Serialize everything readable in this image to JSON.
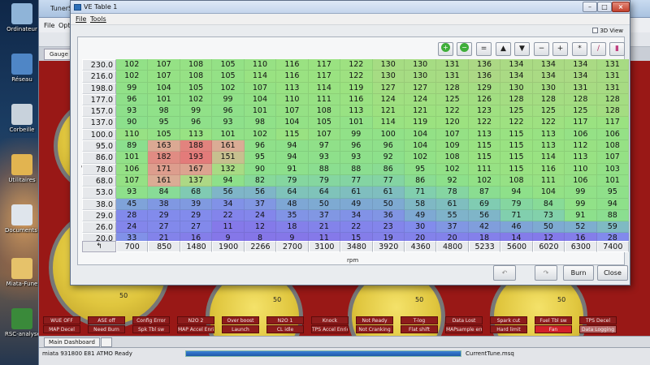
{
  "desktop": {
    "icons": [
      {
        "label": "Ordinateur",
        "color": "#8fb4d8"
      },
      {
        "label": "Réseau",
        "color": "#4f86c6"
      },
      {
        "label": "Corbeille",
        "color": "#c8d2dc"
      },
      {
        "label": "Utilitaires",
        "color": "#e2b450"
      },
      {
        "label": "Documents Raccourci",
        "color": "#dfe5ec"
      },
      {
        "label": "Miata-Fune",
        "color": "#e6c26a"
      },
      {
        "label": "RSC-analyse Raccourci",
        "color": "#3a8a3a"
      }
    ]
  },
  "bg_window": {
    "title": "TunerS",
    "menu": [
      "File",
      "Opti"
    ],
    "tab": "Gauge Cl",
    "gauge_labels": [
      "50",
      "50",
      "50",
      "50"
    ],
    "indicators_row1": [
      "WUE OFF",
      "ASE off",
      "Config Error",
      "N2O 2",
      "Over boost",
      "N2O 1",
      "Knock",
      "Not Ready",
      "T-log",
      "Data Lost",
      "Spark cut",
      "Fuel Tbl sw",
      "TPS Decel"
    ],
    "indicators_row2": [
      "MAP Decel",
      "Need Burn",
      "Spk Tbl sw",
      "MAP Accel Enrich",
      "Launch",
      "CL idle",
      "TPS Accel Enrich",
      "Not Cranking",
      "Flat shift",
      "MAPsample error",
      "Hard limit",
      "Fan",
      "Data Logging"
    ],
    "main_tab": "Main Dashboard",
    "status_left": "miata 931800 E81 ATMO Ready",
    "status_right": "CurrentTune.msq",
    "progress": 1.0
  },
  "dialog": {
    "title": "VE Table 1",
    "menu": [
      "File",
      "Tools"
    ],
    "view3d_label": "3D View",
    "side_axis_label": [
      "f",
      "u",
      "e",
      "l",
      "l",
      "o",
      "a",
      "d",
      "",
      "%"
    ],
    "toolbar": [
      "+",
      "−",
      "=",
      "▲",
      "▼",
      "−",
      "+",
      "*",
      "/",
      "▮"
    ],
    "corner_icon": "↰",
    "x_axis_title": "rpm",
    "burn_label": "Burn",
    "close_label": "Close",
    "y_axis": [
      "230.0",
      "216.0",
      "198.0",
      "177.0",
      "157.0",
      "137.0",
      "100.0",
      "95.0",
      "86.0",
      "78.0",
      "68.0",
      "53.0",
      "38.0",
      "29.0",
      "26.0",
      "20.0"
    ],
    "x_axis": [
      "700",
      "850",
      "1480",
      "1900",
      "2266",
      "2700",
      "3100",
      "3480",
      "3920",
      "4360",
      "4800",
      "5233",
      "5600",
      "6020",
      "6300",
      "7400"
    ],
    "table": [
      [
        102,
        107,
        108,
        105,
        110,
        116,
        117,
        122,
        130,
        130,
        131,
        136,
        134,
        134,
        134,
        131
      ],
      [
        102,
        107,
        108,
        105,
        114,
        116,
        117,
        122,
        130,
        130,
        131,
        136,
        134,
        134,
        134,
        131
      ],
      [
        99,
        104,
        105,
        102,
        107,
        113,
        114,
        119,
        127,
        127,
        128,
        129,
        130,
        130,
        131,
        131
      ],
      [
        96,
        101,
        102,
        99,
        104,
        110,
        111,
        116,
        124,
        124,
        125,
        126,
        128,
        128,
        128,
        128
      ],
      [
        93,
        98,
        99,
        96,
        101,
        107,
        108,
        113,
        121,
        121,
        122,
        123,
        125,
        125,
        125,
        128
      ],
      [
        90,
        95,
        96,
        93,
        98,
        104,
        105,
        101,
        114,
        119,
        120,
        122,
        122,
        122,
        117,
        117
      ],
      [
        110,
        105,
        113,
        101,
        102,
        115,
        107,
        99,
        100,
        104,
        107,
        113,
        115,
        113,
        106,
        106
      ],
      [
        89,
        163,
        188,
        161,
        96,
        94,
        97,
        96,
        96,
        104,
        109,
        115,
        115,
        113,
        112,
        108
      ],
      [
        101,
        182,
        193,
        151,
        95,
        94,
        93,
        93,
        92,
        102,
        108,
        115,
        115,
        114,
        113,
        107
      ],
      [
        106,
        171,
        167,
        132,
        90,
        91,
        88,
        88,
        86,
        95,
        102,
        111,
        115,
        116,
        110,
        103
      ],
      [
        107,
        161,
        137,
        94,
        82,
        79,
        79,
        77,
        77,
        86,
        92,
        102,
        108,
        111,
        106,
        101
      ],
      [
        93,
        84,
        68,
        56,
        56,
        64,
        64,
        61,
        61,
        71,
        78,
        87,
        94,
        104,
        99,
        95
      ],
      [
        45,
        38,
        39,
        34,
        37,
        48,
        50,
        49,
        50,
        58,
        61,
        69,
        79,
        84,
        99,
        94
      ],
      [
        28,
        29,
        29,
        22,
        24,
        35,
        37,
        34,
        36,
        49,
        55,
        56,
        71,
        73,
        91,
        88
      ],
      [
        24,
        27,
        27,
        11,
        12,
        18,
        21,
        22,
        23,
        30,
        37,
        42,
        46,
        50,
        52,
        59
      ],
      [
        33,
        21,
        16,
        9,
        8,
        9,
        11,
        15,
        19,
        20,
        20,
        18,
        14,
        12,
        16,
        28
      ]
    ]
  }
}
